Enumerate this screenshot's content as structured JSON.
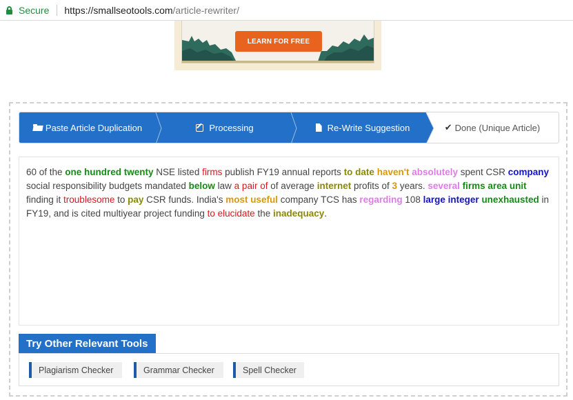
{
  "browser": {
    "secure_label": "Secure",
    "url_host": "https://smallseotools.com",
    "url_path": "/article-rewriter/"
  },
  "ad": {
    "cta_label": "LEARN FOR FREE"
  },
  "steps": [
    {
      "label": "Paste Article Duplication",
      "icon": "folder-open-icon",
      "state": "complete"
    },
    {
      "label": "Processing",
      "icon": "edit-icon",
      "state": "complete"
    },
    {
      "label": "Re-Write Suggestion",
      "icon": "file-icon",
      "state": "complete"
    },
    {
      "label": "Done (Unique Article)",
      "icon": "check-icon",
      "state": "current"
    }
  ],
  "article": {
    "segments": [
      {
        "text": "60 of the ",
        "style": "plain"
      },
      {
        "text": "one hundred twenty",
        "style": "green"
      },
      {
        "text": " NSE listed ",
        "style": "plain"
      },
      {
        "text": "firms",
        "style": "red"
      },
      {
        "text": " publish FY19 annual reports ",
        "style": "plain"
      },
      {
        "text": "to date",
        "style": "olive"
      },
      {
        "text": " ",
        "style": "plain"
      },
      {
        "text": "haven't",
        "style": "orange"
      },
      {
        "text": " ",
        "style": "plain"
      },
      {
        "text": "absolutely",
        "style": "pink"
      },
      {
        "text": " spent CSR ",
        "style": "plain"
      },
      {
        "text": "company",
        "style": "blue"
      },
      {
        "text": " social responsibility budgets mandated ",
        "style": "plain"
      },
      {
        "text": "below",
        "style": "green"
      },
      {
        "text": " law ",
        "style": "plain"
      },
      {
        "text": "a pair of",
        "style": "red"
      },
      {
        "text": " of average ",
        "style": "plain"
      },
      {
        "text": "internet",
        "style": "olive"
      },
      {
        "text": " profits of ",
        "style": "plain"
      },
      {
        "text": "3",
        "style": "orange"
      },
      {
        "text": " years. ",
        "style": "plain"
      },
      {
        "text": "several",
        "style": "pink"
      },
      {
        "text": " ",
        "style": "plain"
      },
      {
        "text": "firms area unit",
        "style": "green"
      },
      {
        "text": " finding it ",
        "style": "plain"
      },
      {
        "text": "troublesome",
        "style": "red"
      },
      {
        "text": " to ",
        "style": "plain"
      },
      {
        "text": "pay",
        "style": "olive"
      },
      {
        "text": " CSR funds. India's ",
        "style": "plain"
      },
      {
        "text": "most useful",
        "style": "orange"
      },
      {
        "text": " company TCS has ",
        "style": "plain"
      },
      {
        "text": "regarding",
        "style": "pink"
      },
      {
        "text": " 108 ",
        "style": "plain"
      },
      {
        "text": "large integer",
        "style": "blue"
      },
      {
        "text": " ",
        "style": "plain"
      },
      {
        "text": "unexhausted",
        "style": "green"
      },
      {
        "text": " in FY19, and is cited multiyear project funding ",
        "style": "plain"
      },
      {
        "text": "to elucidate",
        "style": "red"
      },
      {
        "text": " the ",
        "style": "plain"
      },
      {
        "text": "inadequacy",
        "style": "olive"
      },
      {
        "text": ".",
        "style": "plain"
      }
    ]
  },
  "relevant_tools": {
    "heading": "Try Other Relevant Tools",
    "links": [
      {
        "label": "Plagiarism Checker"
      },
      {
        "label": "Grammar Checker"
      },
      {
        "label": "Spell Checker"
      }
    ]
  },
  "colors": {
    "step_active": "#2370c8",
    "step_done_bg": "#ffffff",
    "cta": "#e8641e",
    "green": "#168a16",
    "red": "#e0141e",
    "orange": "#d79a00",
    "pink": "#dc7ce4",
    "blue": "#1212c8",
    "olive": "#8a8a00"
  }
}
